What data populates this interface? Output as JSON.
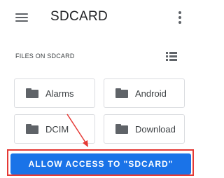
{
  "app_bar": {
    "title": "SDCARD",
    "menu_icon": "hamburger-menu-icon",
    "overflow_icon": "more-vert-icon"
  },
  "section": {
    "header": "FILES ON SDCARD",
    "view_toggle_icon": "list-view-icon"
  },
  "folders": [
    {
      "name": "Alarms",
      "icon": "folder-icon"
    },
    {
      "name": "Android",
      "icon": "folder-icon"
    },
    {
      "name": "DCIM",
      "icon": "folder-icon"
    },
    {
      "name": "Download",
      "icon": "folder-icon"
    }
  ],
  "action": {
    "allow_label": "ALLOW ACCESS TO \"SDCARD\""
  },
  "colors": {
    "accent": "#1a73e8",
    "annotation": "#e53935",
    "icon_gray": "#5f6368"
  }
}
